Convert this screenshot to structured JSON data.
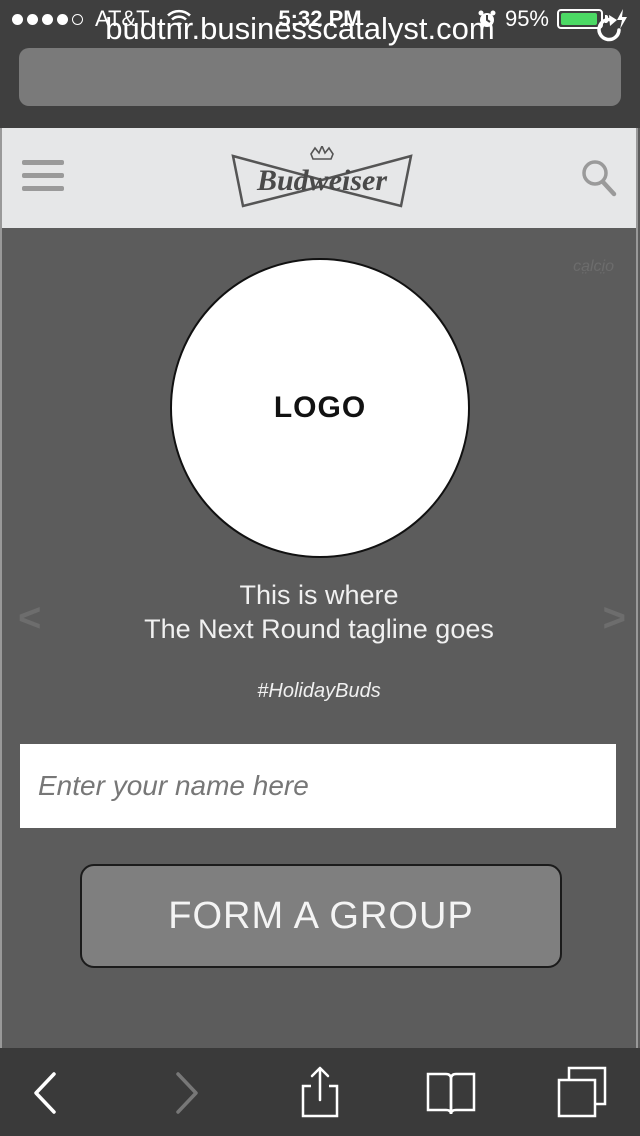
{
  "status_bar": {
    "carrier": "AT&T",
    "time": "5:32 PM",
    "battery_percent": "95%",
    "battery_level": 0.95,
    "signal_bars_filled": 4,
    "signal_bars_total": 5,
    "icons": [
      "wifi-icon",
      "alarm-icon",
      "charging-icon"
    ]
  },
  "browser": {
    "url": "budtnr.businesscatalyst.com",
    "toolbar_icons": [
      "back-icon",
      "forward-icon",
      "share-icon",
      "bookmarks-icon",
      "tabs-icon"
    ]
  },
  "header": {
    "brand": "Budweiser",
    "icons": [
      "menu-icon",
      "search-icon"
    ]
  },
  "main": {
    "corner_mark": "ca̤lci̤o",
    "logo_placeholder": "LOGO",
    "tagline_line1": "This is where",
    "tagline_line2": "The Next Round tagline goes",
    "hashtag": "#HolidayBuds",
    "name_placeholder": "Enter your name here",
    "button_label": "FORM A GROUP",
    "nav_left": "<",
    "nav_right": ">"
  },
  "colors": {
    "background": "#5c5c5c",
    "header_bg": "#e6e7e8",
    "button_bg": "#7f7f7f",
    "battery_green": "#4cd964"
  }
}
